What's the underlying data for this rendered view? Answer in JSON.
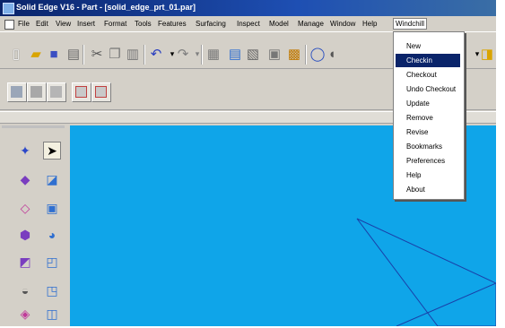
{
  "window": {
    "title": "Solid Edge V16 - Part - [solid_edge_prt_01.par]"
  },
  "menubar": {
    "items": [
      {
        "label": "File"
      },
      {
        "label": "Edit"
      },
      {
        "label": "View"
      },
      {
        "label": "Insert"
      },
      {
        "label": "Format"
      },
      {
        "label": "Tools"
      },
      {
        "label": "Features"
      },
      {
        "label": "Surfacing"
      },
      {
        "label": "Inspect"
      },
      {
        "label": "Model"
      },
      {
        "label": "Manage"
      },
      {
        "label": "Window"
      },
      {
        "label": "Help"
      },
      {
        "label": "Windchill"
      }
    ]
  },
  "windchill_menu": {
    "items": [
      {
        "label": "New"
      },
      {
        "label": "Checkin"
      },
      {
        "label": "Checkout"
      },
      {
        "label": "Undo Checkout"
      },
      {
        "label": "Update"
      },
      {
        "label": "Remove"
      },
      {
        "label": "Revise"
      },
      {
        "label": "Bookmarks"
      },
      {
        "label": "Preferences"
      },
      {
        "label": "Help"
      },
      {
        "label": "About"
      }
    ],
    "selected": "Checkin"
  },
  "colors": {
    "viewport": "#0fa5e9",
    "titlebar": "#0a246a",
    "selection": "#0a246a"
  }
}
